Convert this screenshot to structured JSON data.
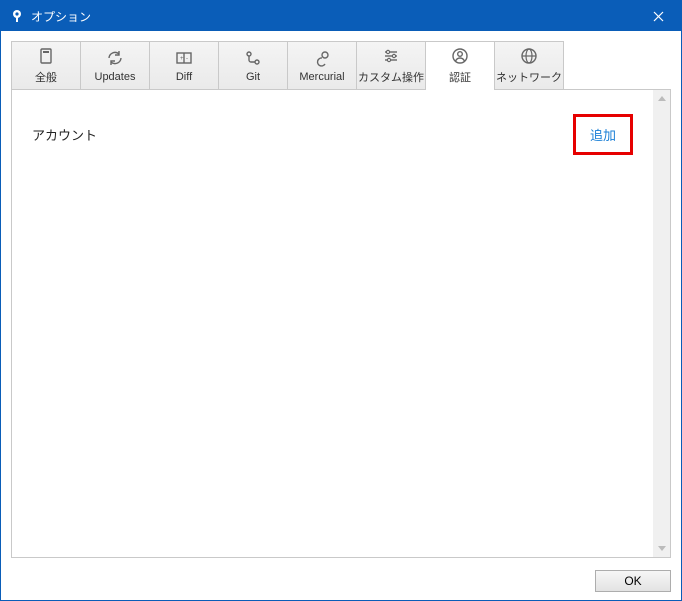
{
  "window": {
    "title": "オプション"
  },
  "tabs": [
    {
      "id": "general",
      "label": "全般",
      "icon": "general-icon"
    },
    {
      "id": "updates",
      "label": "Updates",
      "icon": "updates-icon"
    },
    {
      "id": "diff",
      "label": "Diff",
      "icon": "diff-icon"
    },
    {
      "id": "git",
      "label": "Git",
      "icon": "git-icon"
    },
    {
      "id": "mercurial",
      "label": "Mercurial",
      "icon": "mercurial-icon"
    },
    {
      "id": "custom",
      "label": "カスタム操作",
      "icon": "custom-icon"
    },
    {
      "id": "auth",
      "label": "認証",
      "icon": "auth-icon",
      "active": true
    },
    {
      "id": "network",
      "label": "ネットワーク",
      "icon": "network-icon"
    }
  ],
  "content": {
    "account_label": "アカウント",
    "add_label": "追加"
  },
  "footer": {
    "ok_label": "OK"
  }
}
